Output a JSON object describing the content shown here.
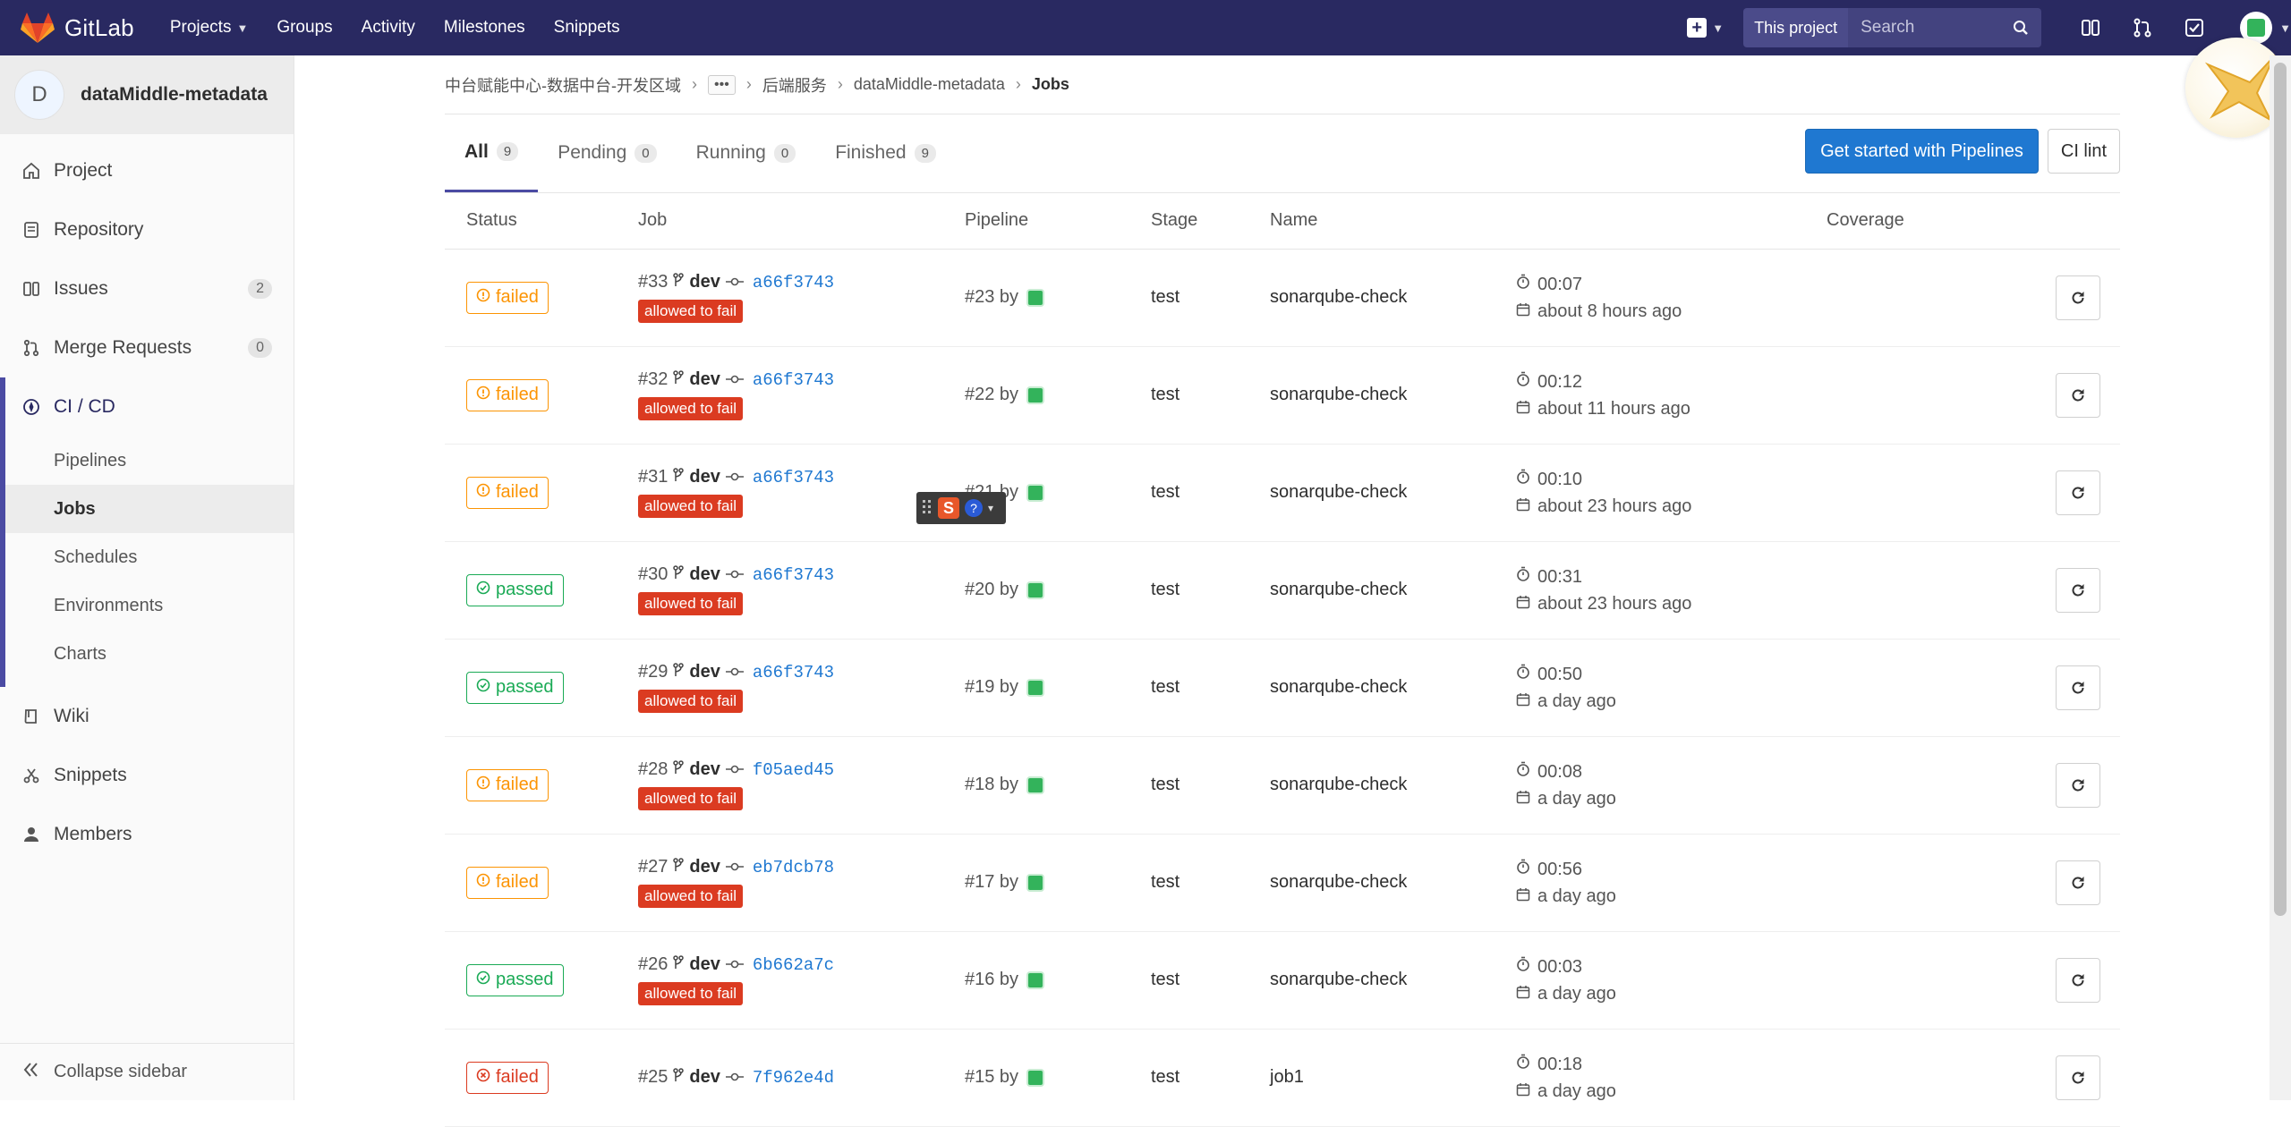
{
  "topnav": {
    "brand": "GitLab",
    "links": [
      {
        "label": "Projects",
        "caret": true
      },
      {
        "label": "Groups"
      },
      {
        "label": "Activity"
      },
      {
        "label": "Milestones"
      },
      {
        "label": "Snippets"
      }
    ],
    "search_scope": "This project",
    "search_placeholder": "Search"
  },
  "sidebar": {
    "avatar_letter": "D",
    "project_name": "dataMiddle-metadata",
    "items": [
      {
        "label": "Project",
        "icon": "home-icon"
      },
      {
        "label": "Repository",
        "icon": "doc-icon"
      },
      {
        "label": "Issues",
        "icon": "issues-icon",
        "count": "2"
      },
      {
        "label": "Merge Requests",
        "icon": "merge-request-icon",
        "count": "0"
      }
    ],
    "cicd": {
      "label": "CI / CD",
      "sub": [
        "Pipelines",
        "Jobs",
        "Schedules",
        "Environments",
        "Charts"
      ],
      "active_sub": "Jobs"
    },
    "items_after": [
      {
        "label": "Wiki",
        "icon": "book-icon"
      },
      {
        "label": "Snippets",
        "icon": "scissors-icon"
      },
      {
        "label": "Members",
        "icon": "user-icon"
      }
    ],
    "collapse_label": "Collapse sidebar"
  },
  "breadcrumb": {
    "group": "中台赋能中心-数据中台-开发区域",
    "more": "•••",
    "sub": "后端服务",
    "project": "dataMiddle-metadata",
    "current": "Jobs"
  },
  "tabs": [
    {
      "label": "All",
      "count": "9",
      "active": true
    },
    {
      "label": "Pending",
      "count": "0"
    },
    {
      "label": "Running",
      "count": "0"
    },
    {
      "label": "Finished",
      "count": "9"
    }
  ],
  "actions": {
    "primary": "Get started with Pipelines",
    "secondary": "CI lint"
  },
  "table": {
    "headers": [
      "Status",
      "Job",
      "Pipeline",
      "Stage",
      "Name",
      "",
      "Coverage",
      ""
    ],
    "allow_fail_label": "allowed to fail",
    "rows": [
      {
        "status": "failed",
        "kind": "warn",
        "job": "#33",
        "branch": "dev",
        "sha": "a66f3743",
        "allowed": true,
        "pipeline": "#23 by",
        "stage": "test",
        "name": "sonarqube-check",
        "duration": "00:07",
        "ago": "about 8 hours ago"
      },
      {
        "status": "failed",
        "kind": "warn",
        "job": "#32",
        "branch": "dev",
        "sha": "a66f3743",
        "allowed": true,
        "pipeline": "#22 by",
        "stage": "test",
        "name": "sonarqube-check",
        "duration": "00:12",
        "ago": "about 11 hours ago"
      },
      {
        "status": "failed",
        "kind": "warn",
        "job": "#31",
        "branch": "dev",
        "sha": "a66f3743",
        "allowed": true,
        "pipeline": "#21 by",
        "stage": "test",
        "name": "sonarqube-check",
        "duration": "00:10",
        "ago": "about 23 hours ago"
      },
      {
        "status": "passed",
        "kind": "ok",
        "job": "#30",
        "branch": "dev",
        "sha": "a66f3743",
        "allowed": true,
        "pipeline": "#20 by",
        "stage": "test",
        "name": "sonarqube-check",
        "duration": "00:31",
        "ago": "about 23 hours ago"
      },
      {
        "status": "passed",
        "kind": "ok",
        "job": "#29",
        "branch": "dev",
        "sha": "a66f3743",
        "allowed": true,
        "pipeline": "#19 by",
        "stage": "test",
        "name": "sonarqube-check",
        "duration": "00:50",
        "ago": "a day ago"
      },
      {
        "status": "failed",
        "kind": "warn",
        "job": "#28",
        "branch": "dev",
        "sha": "f05aed45",
        "allowed": true,
        "pipeline": "#18 by",
        "stage": "test",
        "name": "sonarqube-check",
        "duration": "00:08",
        "ago": "a day ago"
      },
      {
        "status": "failed",
        "kind": "warn",
        "job": "#27",
        "branch": "dev",
        "sha": "eb7dcb78",
        "allowed": true,
        "pipeline": "#17 by",
        "stage": "test",
        "name": "sonarqube-check",
        "duration": "00:56",
        "ago": "a day ago"
      },
      {
        "status": "passed",
        "kind": "ok",
        "job": "#26",
        "branch": "dev",
        "sha": "6b662a7c",
        "allowed": true,
        "pipeline": "#16 by",
        "stage": "test",
        "name": "sonarqube-check",
        "duration": "00:03",
        "ago": "a day ago"
      },
      {
        "status": "failed",
        "kind": "err",
        "job": "#25",
        "branch": "dev",
        "sha": "7f962e4d",
        "allowed": false,
        "pipeline": "#15 by",
        "stage": "test",
        "name": "job1",
        "duration": "00:18",
        "ago": "a day ago"
      }
    ]
  },
  "colors": {
    "nav": "#292961",
    "primary": "#1f78d1",
    "failed": "#fc9403",
    "passed": "#1aaa55",
    "error": "#db3b21"
  }
}
